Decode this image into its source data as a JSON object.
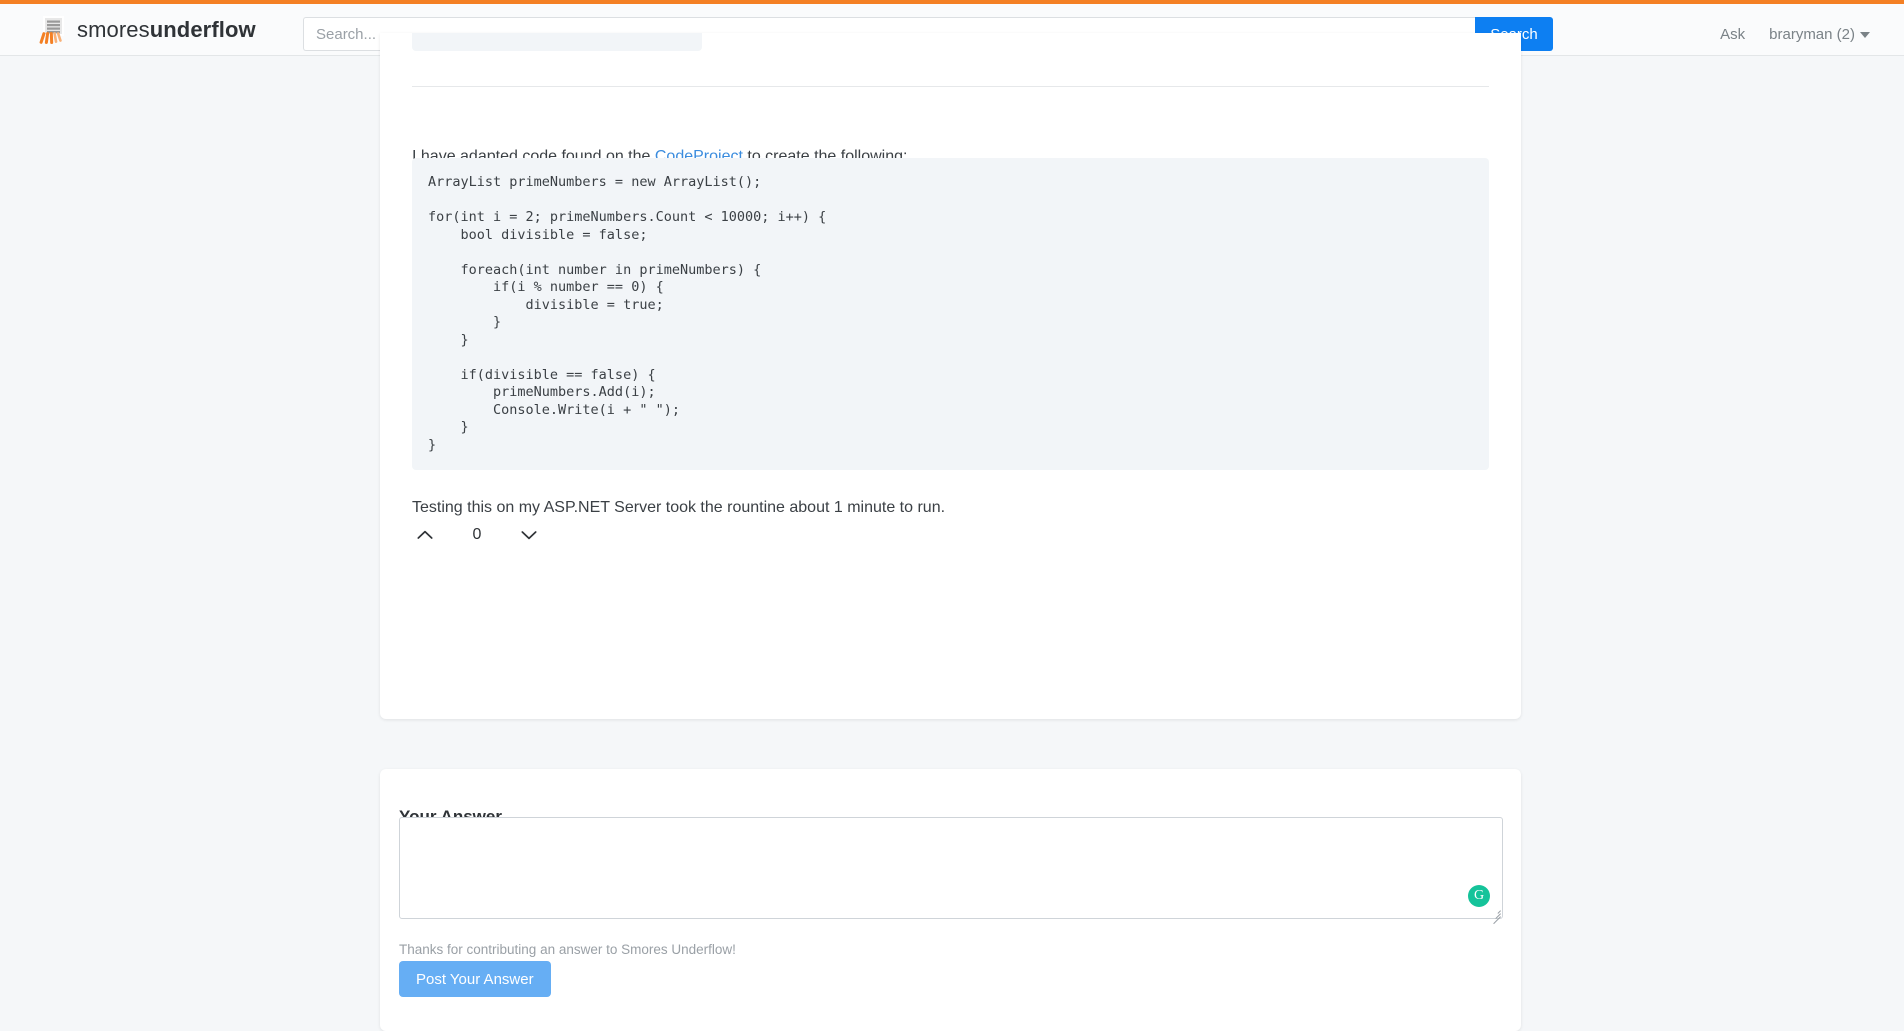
{
  "header": {
    "brand": {
      "light": "smores",
      "bold": "underflow",
      "logo_icon": "smores-stack-icon"
    },
    "search": {
      "placeholder": "Search...",
      "value": "",
      "button_label": "Search"
    },
    "links": [
      {
        "name": "ask",
        "label": "Ask"
      },
      {
        "name": "user-menu",
        "label": "braryman (2)"
      }
    ],
    "accent_color": "#f48024",
    "search_button_color": "#0d7ff2"
  },
  "answer": {
    "intro_before_link": "I have adapted code found on the ",
    "link_text": "CodeProject",
    "intro_after_link": " to create the following:",
    "code": "ArrayList primeNumbers = new ArrayList();\n\nfor(int i = 2; primeNumbers.Count < 10000; i++) {\n    bool divisible = false;\n\n    foreach(int number in primeNumbers) {\n        if(i % number == 0) {\n            divisible = true;\n        }\n    }\n\n    if(divisible == false) {\n        primeNumbers.Add(i);\n        Console.Write(i + \" \");\n    }\n}",
    "closing_text": "Testing this on my ASP.NET Server took the rountine about 1 minute to run.",
    "vote": {
      "count": "0",
      "up_icon": "chevron-up-icon",
      "down_icon": "chevron-down-icon"
    }
  },
  "answer_form": {
    "title": "Your Answer",
    "textarea_value": "",
    "textarea_placeholder": "",
    "hint": "Thanks for contributing an answer to Smores Underflow!",
    "submit_label": "Post Your Answer",
    "submit_color": "#66aef4",
    "grammarly": {
      "icon": "grammarly-icon",
      "glyph": "G",
      "color": "#15c39a"
    }
  }
}
